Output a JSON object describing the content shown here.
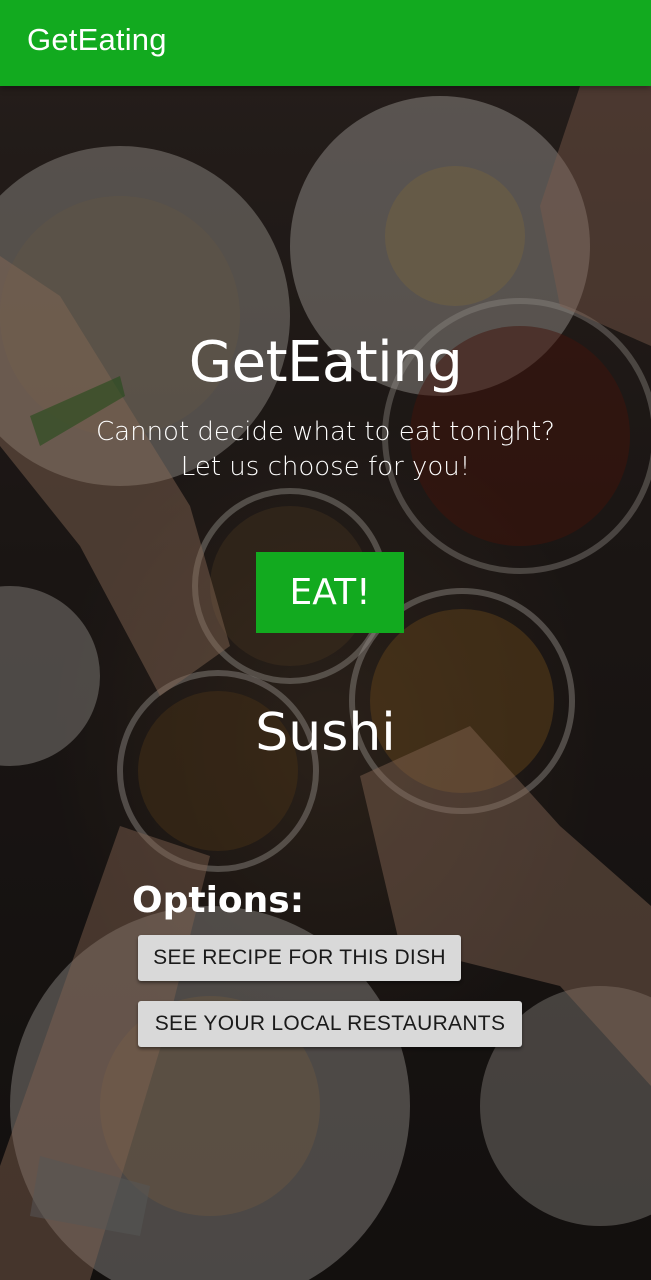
{
  "app_bar": {
    "title": "GetEating",
    "color": "#12aa1f"
  },
  "hero": {
    "title": "GetEating",
    "tagline_line1": "Cannot decide what to eat tonight?",
    "tagline_line2": "Let us choose for you!"
  },
  "eat_button": {
    "label": "EAT!",
    "color": "#12aa1f"
  },
  "result": {
    "dish": "Sushi"
  },
  "options": {
    "heading": "Options:",
    "recipe_button": "SEE RECIPE FOR THIS DISH",
    "restaurants_button": "SEE YOUR LOCAL RESTAURANTS"
  },
  "background": {
    "description_icon": "dinner-table-toast-photo"
  }
}
